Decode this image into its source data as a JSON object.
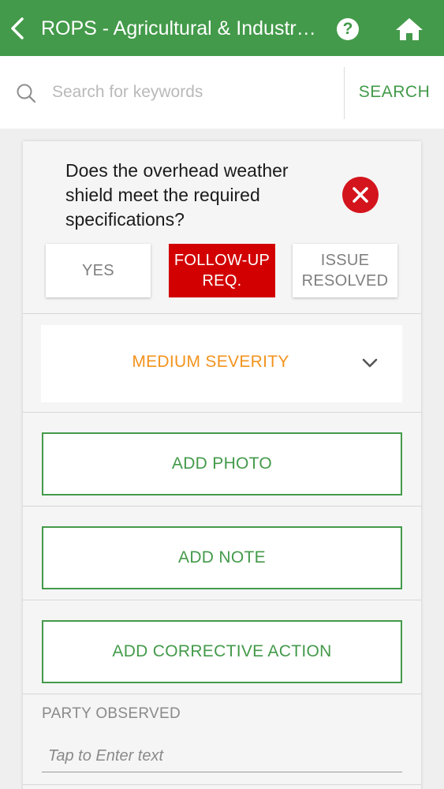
{
  "header": {
    "title": "ROPS - Agricultural & Industrial Tractors",
    "back_icon": "chevron-left-icon",
    "help_icon": "question-icon",
    "help_glyph": "?",
    "home_icon": "home-icon",
    "background_color": "#439a4a"
  },
  "search": {
    "placeholder": "Search for keywords",
    "value": "",
    "button_label": "SEARCH",
    "icon": "search-icon"
  },
  "question": {
    "text": "Does the overhead weather shield meet the required specifications?",
    "clear_icon": "close-circle-icon",
    "responses": [
      {
        "label": "YES",
        "selected": false
      },
      {
        "label": "FOLLOW-UP REQ.",
        "selected": true
      },
      {
        "label": "ISSUE RESOLVED",
        "selected": false
      }
    ],
    "severity": {
      "label": "MEDIUM SEVERITY",
      "icon": "chevron-down-icon",
      "color": "#f2931d"
    },
    "actions": {
      "add_photo": "ADD PHOTO",
      "add_note": "ADD NOTE",
      "add_corrective_action": "ADD CORRECTIVE ACTION"
    },
    "party_observed": {
      "label": "PARTY OBSERVED",
      "placeholder": "Tap to Enter text",
      "value": ""
    }
  },
  "colors": {
    "accent_green": "#439a4a",
    "alert_red": "#d20000",
    "severity_orange": "#f2931d"
  }
}
